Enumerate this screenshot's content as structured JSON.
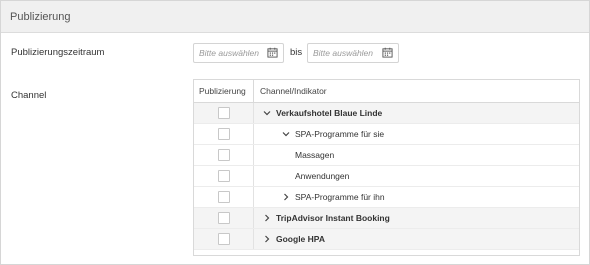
{
  "header": {
    "title": "Publizierung"
  },
  "period": {
    "label": "Publizierungszeitraum",
    "from_placeholder": "Bitte auswählen",
    "separator": "bis",
    "to_placeholder": "Bitte auswählen"
  },
  "channel": {
    "label": "Channel",
    "columns": {
      "publication": "Publizierung",
      "channel": "Channel/Indikator"
    },
    "rows": [
      {
        "name": "Verkaufshotel Blaue Linde",
        "level": 0,
        "expander": "chevron-down-icon",
        "checked": false
      },
      {
        "name": "SPA-Programme für sie",
        "level": 1,
        "expander": "chevron-down-icon",
        "checked": false
      },
      {
        "name": "Massagen",
        "level": 2,
        "expander": "",
        "checked": false
      },
      {
        "name": "Anwendungen",
        "level": 2,
        "expander": "",
        "checked": false
      },
      {
        "name": "SPA-Programme für ihn",
        "level": 1,
        "expander": "chevron-right-icon",
        "checked": false
      },
      {
        "name": "TripAdvisor Instant Booking",
        "level": 0,
        "expander": "chevron-right-icon",
        "checked": false
      },
      {
        "name": "Google HPA",
        "level": 0,
        "expander": "chevron-right-icon",
        "checked": false
      }
    ]
  },
  "colors": {
    "header_bg": "#f0f0f0",
    "border": "#d9d9d9",
    "placeholder": "#9a9a9a"
  }
}
